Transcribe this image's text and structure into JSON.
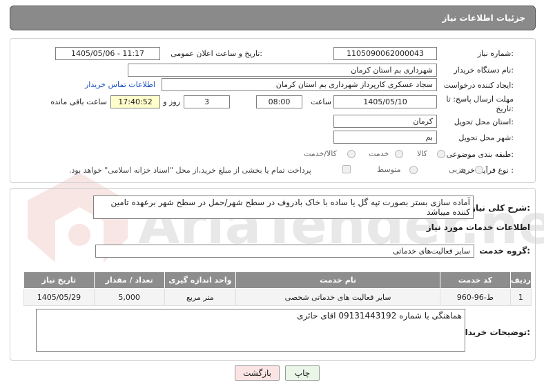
{
  "header": {
    "title": "جزئیات اطلاعات نیاز"
  },
  "form": {
    "need_number_label": "شماره نیاز:",
    "need_number": "1105090062000043",
    "announce_label": "تاریخ و ساعت اعلان عمومی:",
    "announce_value": "1405/05/06 - 11:17",
    "buyer_org_label": "نام دستگاه خریدار:",
    "buyer_org": "شهرداری بم استان کرمان",
    "creator_label": "ایجاد کننده درخواست:",
    "creator": "سجاد عسکری کارپرداز شهرداری بم استان کرمان",
    "contact_link": "اطلاعات تماس خریدار",
    "deadline_label": "مهلت ارسال پاسخ: تا تاریخ:",
    "deadline_date": "1405/05/10",
    "time_label": "ساعت",
    "deadline_time": "08:00",
    "days_value": "3",
    "days_label": "روز و",
    "remaining_time": "17:40:52",
    "remaining_label": "ساعت باقی مانده",
    "province_label": "استان محل تحویل:",
    "province": "کرمان",
    "city_label": "شهر محل تحویل:",
    "city": "بم",
    "category_label": "طبقه بندی موضوعی:",
    "category_options": [
      "کالا",
      "خدمت",
      "کالا/خدمت"
    ],
    "process_label": "نوع فرآیند خرید :",
    "process_options": [
      "جزیی",
      "متوسط"
    ],
    "payment_note": "پرداخت تمام یا بخشی از مبلغ خرید،از محل \"اسناد خزانه اسلامی\" خواهد بود."
  },
  "summary": {
    "label": "شرح کلی نیاز:",
    "text": "آماده سازی بستر بصورت تپه گل یا ساده با خاک بادروف در سطح شهر/حمل در سطح شهر برعهده تامین کننده میباشد"
  },
  "services": {
    "section_title": "اطلاعات خدمات مورد نیاز",
    "group_label": "گروه خدمت:",
    "group_value": "سایر فعالیت‌های خدماتی",
    "columns": [
      "ردیف",
      "کد خدمت",
      "نام خدمت",
      "واحد اندازه گیری",
      "تعداد / مقدار",
      "تاریخ نیاز"
    ],
    "rows": [
      {
        "row": "1",
        "code": "ط-96-960",
        "name": "سایر فعالیت های خدماتی شخصی",
        "unit": "متر مربع",
        "qty": "5,000",
        "date": "1405/05/29"
      }
    ]
  },
  "buyer_notes": {
    "label": "توضیحات خریدار:",
    "text": "هماهنگی با شماره 09131443192 اقای حائری"
  },
  "buttons": {
    "print": "چاپ",
    "back": "بازگشت"
  },
  "watermark": {
    "text": "AriaTender.neT"
  },
  "colors": {
    "header_bg": "#8a8a8a",
    "table_header_bg": "#8d8d8d",
    "link": "#1a4fc4",
    "yellow_field": "#ffffcc",
    "watermark": "#c0392b"
  }
}
